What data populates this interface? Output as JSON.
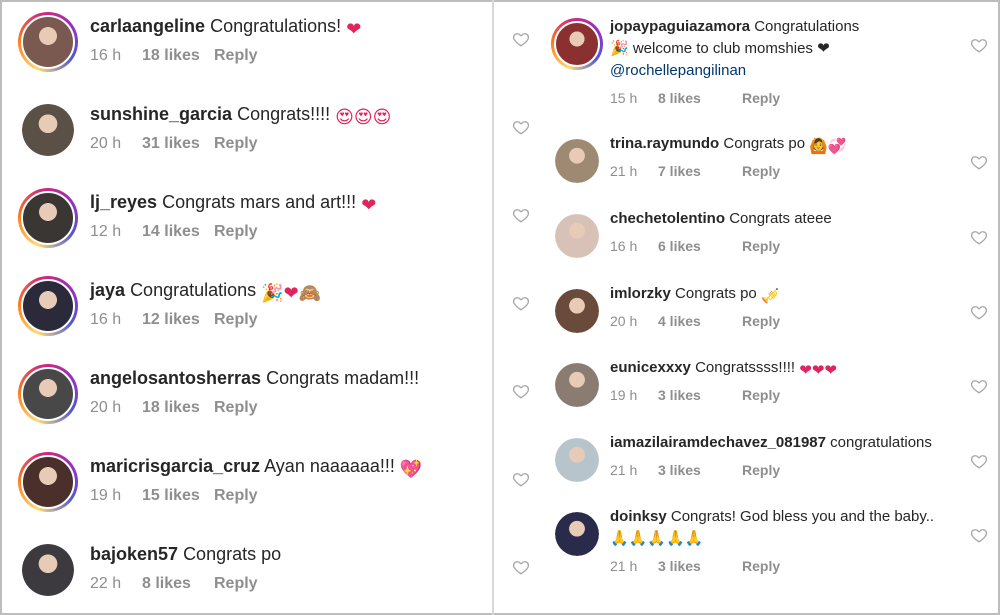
{
  "reply_label": "Reply",
  "left_comments": [
    {
      "username": "carlaangeline",
      "text": "Congratulations!",
      "emoji": "❤",
      "time": "16 h",
      "likes": "18 likes",
      "ring": true,
      "photo": "#7a5a50"
    },
    {
      "username": "sunshine_garcia",
      "text": "Congrats!!!!",
      "emoji": "😍😍😍",
      "time": "20 h",
      "likes": "31 likes",
      "ring": false,
      "photo": "#5a5046"
    },
    {
      "username": "lj_reyes",
      "text": "Congrats mars and art!!!",
      "emoji": "❤",
      "time": "12 h",
      "likes": "14 likes",
      "ring": true,
      "photo": "#3a3634"
    },
    {
      "username": "jaya",
      "text": "Congratulations",
      "emoji": "🎉❤🙈",
      "time": "16 h",
      "likes": "12 likes",
      "ring": true,
      "photo": "#2b2a3a"
    },
    {
      "username": "angelosantosherras",
      "text": "Congrats madam!!!",
      "emoji": "",
      "time": "20 h",
      "likes": "18 likes",
      "ring": true,
      "photo": "#484848"
    },
    {
      "username": "maricrisgarcia_cruz",
      "text": "Ayan naaaaaa!!!",
      "emoji": "💖",
      "time": "19 h",
      "likes": "15 likes",
      "ring": true,
      "photo": "#4a2f2a"
    },
    {
      "username": "bajoken57",
      "text": "Congrats po",
      "emoji": "",
      "time": "22 h",
      "likes": "8 likes",
      "ring": false,
      "photo": "#3c3a3e"
    }
  ],
  "right_comments": [
    {
      "username": "jopaypaguiazamora",
      "text": "Congratulations",
      "line2": "🎉 welcome to club momshies ❤",
      "mention": "@rochellepangilinan",
      "time": "15 h",
      "likes": "8 likes",
      "ring": true,
      "photo": "#8a3030"
    },
    {
      "username": "trina.raymundo",
      "text": "Congrats po",
      "emoji": "🙆💞",
      "time": "21 h",
      "likes": "7 likes",
      "ring": false,
      "photo": "#9e8a72"
    },
    {
      "username": "chechetolentino",
      "text": "Congrats ateee",
      "emoji": "",
      "time": "16 h",
      "likes": "6 likes",
      "ring": false,
      "photo": "#d8c2b8"
    },
    {
      "username": "imlorzky",
      "text": "Congrats po",
      "emoji": "🎺",
      "time": "20 h",
      "likes": "4 likes",
      "ring": false,
      "photo": "#6a4a3a"
    },
    {
      "username": "eunicexxxy",
      "text": "Congratssss!!!!",
      "emoji": "❤❤❤",
      "time": "19 h",
      "likes": "3 likes",
      "ring": false,
      "photo": "#8a7c70"
    },
    {
      "username": "iamazilairamdechavez_081987",
      "text": "congratulations",
      "emoji": "",
      "time": "21 h",
      "likes": "3 likes",
      "ring": false,
      "photo": "#b8c4cc"
    },
    {
      "username": "doinksy",
      "text": "Congrats! God bless you and the baby..",
      "line2": "🙏🙏🙏🙏🙏",
      "time": "21 h",
      "likes": "3 likes",
      "ring": false,
      "photo": "#2a2a4a"
    }
  ]
}
